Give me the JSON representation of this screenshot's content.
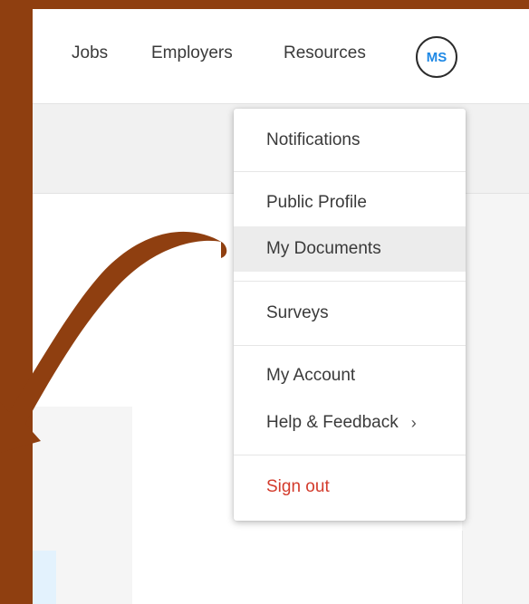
{
  "nav": {
    "links": [
      "Jobs",
      "Employers",
      "Resources"
    ],
    "avatar_initials": "MS"
  },
  "menu": {
    "items": {
      "notifications": "Notifications",
      "public_profile": "Public Profile",
      "my_documents": "My Documents",
      "surveys": "Surveys",
      "my_account": "My Account",
      "help_feedback": "Help & Feedback",
      "sign_out": "Sign out"
    },
    "active_item": "My Documents",
    "help_chevron": "›"
  },
  "colors": {
    "annotation": "#8f3f10",
    "accent": "#1e88e5",
    "sign_out": "#d33b2c"
  },
  "icons": {
    "annotation_arrow": "curved-arrow-icon",
    "help_chevron": "chevron-right-icon"
  }
}
